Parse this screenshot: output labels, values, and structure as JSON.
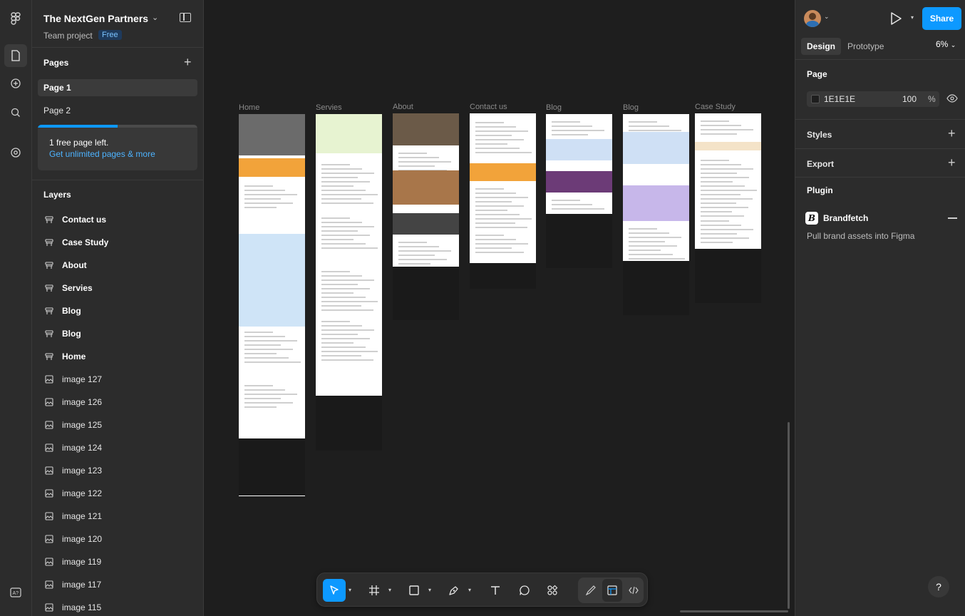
{
  "project": {
    "name": "The NextGen Partners",
    "team": "Team project",
    "plan_badge": "Free"
  },
  "pages": {
    "title": "Pages",
    "items": [
      {
        "label": "Page 1",
        "selected": true
      },
      {
        "label": "Page 2",
        "selected": false
      }
    ],
    "upsell": {
      "message": "1 free page left.",
      "link": "Get unlimited pages & more",
      "usage_fraction": 0.5
    }
  },
  "layers": {
    "title": "Layers",
    "items": [
      {
        "label": "Contact us",
        "type": "frame"
      },
      {
        "label": "Case Study",
        "type": "frame"
      },
      {
        "label": "About",
        "type": "frame"
      },
      {
        "label": "Servies",
        "type": "frame"
      },
      {
        "label": "Blog",
        "type": "frame"
      },
      {
        "label": "Blog",
        "type": "frame"
      },
      {
        "label": "Home",
        "type": "frame"
      },
      {
        "label": "image 127",
        "type": "image"
      },
      {
        "label": "image 126",
        "type": "image"
      },
      {
        "label": "image 125",
        "type": "image"
      },
      {
        "label": "image 124",
        "type": "image"
      },
      {
        "label": "image 123",
        "type": "image"
      },
      {
        "label": "image 122",
        "type": "image"
      },
      {
        "label": "image 121",
        "type": "image"
      },
      {
        "label": "image 120",
        "type": "image"
      },
      {
        "label": "image 119",
        "type": "image"
      },
      {
        "label": "image 117",
        "type": "image"
      },
      {
        "label": "image 115",
        "type": "image"
      }
    ]
  },
  "canvas": {
    "frames": [
      {
        "label": "Home"
      },
      {
        "label": "Servies"
      },
      {
        "label": "About"
      },
      {
        "label": "Contact us"
      },
      {
        "label": "Blog"
      },
      {
        "label": "Blog"
      },
      {
        "label": "Case Study"
      }
    ]
  },
  "toolbar": {
    "tools": [
      "move-tool",
      "frame-tool",
      "rectangle-tool",
      "pen-tool",
      "text-tool",
      "comment-tool",
      "actions-tool"
    ],
    "modes": [
      "draw-mode",
      "design-mode",
      "dev-mode"
    ]
  },
  "right_panel": {
    "share_label": "Share",
    "tabs": [
      {
        "label": "Design",
        "selected": true
      },
      {
        "label": "Prototype",
        "selected": false
      }
    ],
    "zoom": "6%",
    "page_section": {
      "title": "Page",
      "fill_hex": "1E1E1E",
      "opacity": "100",
      "percent_sign": "%"
    },
    "styles_title": "Styles",
    "export_title": "Export",
    "plugin": {
      "title": "Plugin",
      "name": "Brandfetch",
      "description": "Pull brand assets into Figma"
    },
    "help": "?"
  },
  "colors": {
    "accent": "#0d99ff",
    "panel": "#2c2c2c",
    "canvas": "#1e1e1e"
  }
}
